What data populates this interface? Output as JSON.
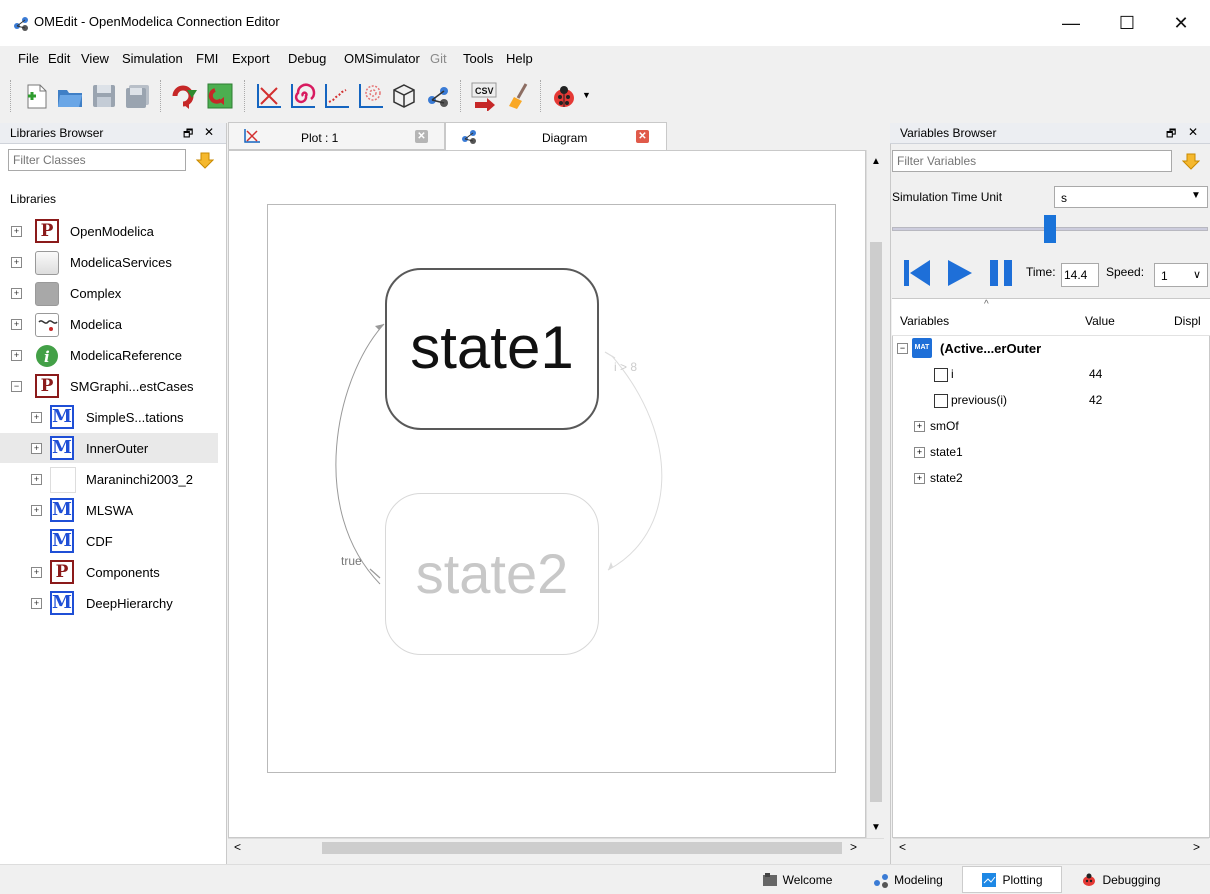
{
  "window": {
    "title": "OMEdit - OpenModelica Connection Editor",
    "minimize_glyph": "—",
    "maximize_glyph": "☐",
    "close_glyph": "✕"
  },
  "menubar": [
    {
      "label": "File",
      "disabled": false
    },
    {
      "label": "Edit",
      "disabled": false
    },
    {
      "label": "View",
      "disabled": false
    },
    {
      "label": "Simulation",
      "disabled": false
    },
    {
      "label": "FMI",
      "disabled": false
    },
    {
      "label": "Export",
      "disabled": false
    },
    {
      "label": "Debug",
      "disabled": false
    },
    {
      "label": "OMSimulator",
      "disabled": false
    },
    {
      "label": "Git",
      "disabled": true
    },
    {
      "label": "Tools",
      "disabled": false
    },
    {
      "label": "Help",
      "disabled": false
    }
  ],
  "toolbar_icons": [
    "new-file-icon",
    "open-folder-icon",
    "save-icon",
    "save-all-icon",
    "check-model-icon",
    "simulate-icon",
    "plot-icon",
    "parametric-plot-icon",
    "array-plot-icon",
    "array-parametric-plot-icon",
    "3d-animation-icon",
    "diagram-icon",
    "export-csv-icon",
    "clear-icon",
    "debugger-icon"
  ],
  "toolbar": {
    "csv_label": "CSV"
  },
  "libraries_browser": {
    "title": "Libraries Browser",
    "float_glyph": "🗗",
    "close_glyph": "✕",
    "filter_placeholder": "Filter Classes",
    "header": "Libraries",
    "items": [
      {
        "label": "OpenModelica",
        "icon": "P",
        "expander": "+",
        "indent": 0
      },
      {
        "label": "ModelicaServices",
        "icon": "box",
        "expander": "+",
        "indent": 0
      },
      {
        "label": "Complex",
        "icon": "graybox",
        "expander": "+",
        "indent": 0
      },
      {
        "label": "Modelica",
        "icon": "modelica",
        "expander": "+",
        "indent": 0
      },
      {
        "label": "ModelicaReference",
        "icon": "info",
        "expander": "+",
        "indent": 0
      },
      {
        "label": "SMGraphi...estCases",
        "icon": "P",
        "expander": "−",
        "indent": 0
      },
      {
        "label": "SimpleS...tations",
        "icon": "M",
        "expander": "+",
        "indent": 1
      },
      {
        "label": "InnerOuter",
        "icon": "M",
        "expander": "+",
        "indent": 1,
        "selected": true
      },
      {
        "label": "Maraninchi2003_2",
        "icon": "blank",
        "expander": "+",
        "indent": 1
      },
      {
        "label": "MLSWA",
        "icon": "M",
        "expander": "+",
        "indent": 1
      },
      {
        "label": "CDF",
        "icon": "M",
        "expander": "",
        "indent": 1
      },
      {
        "label": "Components",
        "icon": "P",
        "expander": "+",
        "indent": 1
      },
      {
        "label": "DeepHierarchy",
        "icon": "M",
        "expander": "+",
        "indent": 1
      }
    ]
  },
  "tabs": [
    {
      "label": "Plot : 1",
      "active": false
    },
    {
      "label": "Diagram",
      "active": true
    }
  ],
  "diagram": {
    "state1": "state1",
    "state2": "state2",
    "transition_true": "true",
    "transition_guard": "i > 8"
  },
  "variables_browser": {
    "title": "Variables Browser",
    "float_glyph": "🗗",
    "close_glyph": "✕",
    "filter_placeholder": "Filter Variables",
    "time_unit_label": "Simulation Time Unit",
    "time_unit_value": "s",
    "slider_position": 0.5,
    "time_label": "Time:",
    "time_value": "14.4",
    "speed_label": "Speed:",
    "speed_value": "1",
    "columns": [
      "Variables",
      "Value",
      "Displ"
    ],
    "root": {
      "label": "(Active...erOuter",
      "badge": "MAT"
    },
    "rows": [
      {
        "name": "i",
        "value": "44",
        "kind": "check"
      },
      {
        "name": "previous(i)",
        "value": "42",
        "kind": "check"
      },
      {
        "name": "smOf",
        "value": "",
        "kind": "expand"
      },
      {
        "name": "state1",
        "value": "",
        "kind": "expand"
      },
      {
        "name": "state2",
        "value": "",
        "kind": "expand"
      }
    ]
  },
  "perspectives": [
    {
      "label": "Welcome",
      "icon": "welcome-icon"
    },
    {
      "label": "Modeling",
      "icon": "modeling-icon"
    },
    {
      "label": "Plotting",
      "icon": "plotting-icon",
      "active": true
    },
    {
      "label": "Debugging",
      "icon": "debugging-icon"
    }
  ]
}
